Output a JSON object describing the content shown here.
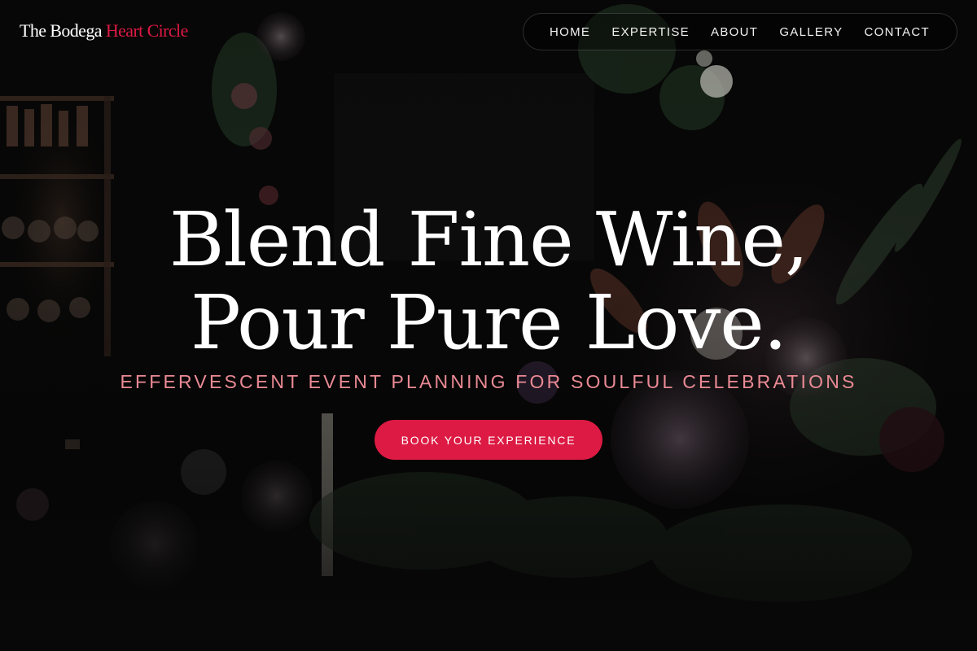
{
  "header": {
    "logo": {
      "primary": "The Bodega",
      "accent": "Heart Circle"
    },
    "nav": [
      {
        "label": "HOME"
      },
      {
        "label": "EXPERTISE"
      },
      {
        "label": "ABOUT"
      },
      {
        "label": "GALLERY"
      },
      {
        "label": "CONTACT"
      }
    ]
  },
  "hero": {
    "headline_line1": "Blend Fine Wine,",
    "headline_line2": "Pour Pure Love.",
    "tagline": "EFFERVESCENT EVENT PLANNING FOR SOULFUL CELEBRATIONS",
    "cta_label": "BOOK YOUR EXPERIENCE",
    "background_image": "dark floral arrangement with candles and wine shelves"
  },
  "colors": {
    "accent": "#dc1a43",
    "tagline": "#ea8a94",
    "background": "#050505",
    "text": "#ffffff"
  }
}
